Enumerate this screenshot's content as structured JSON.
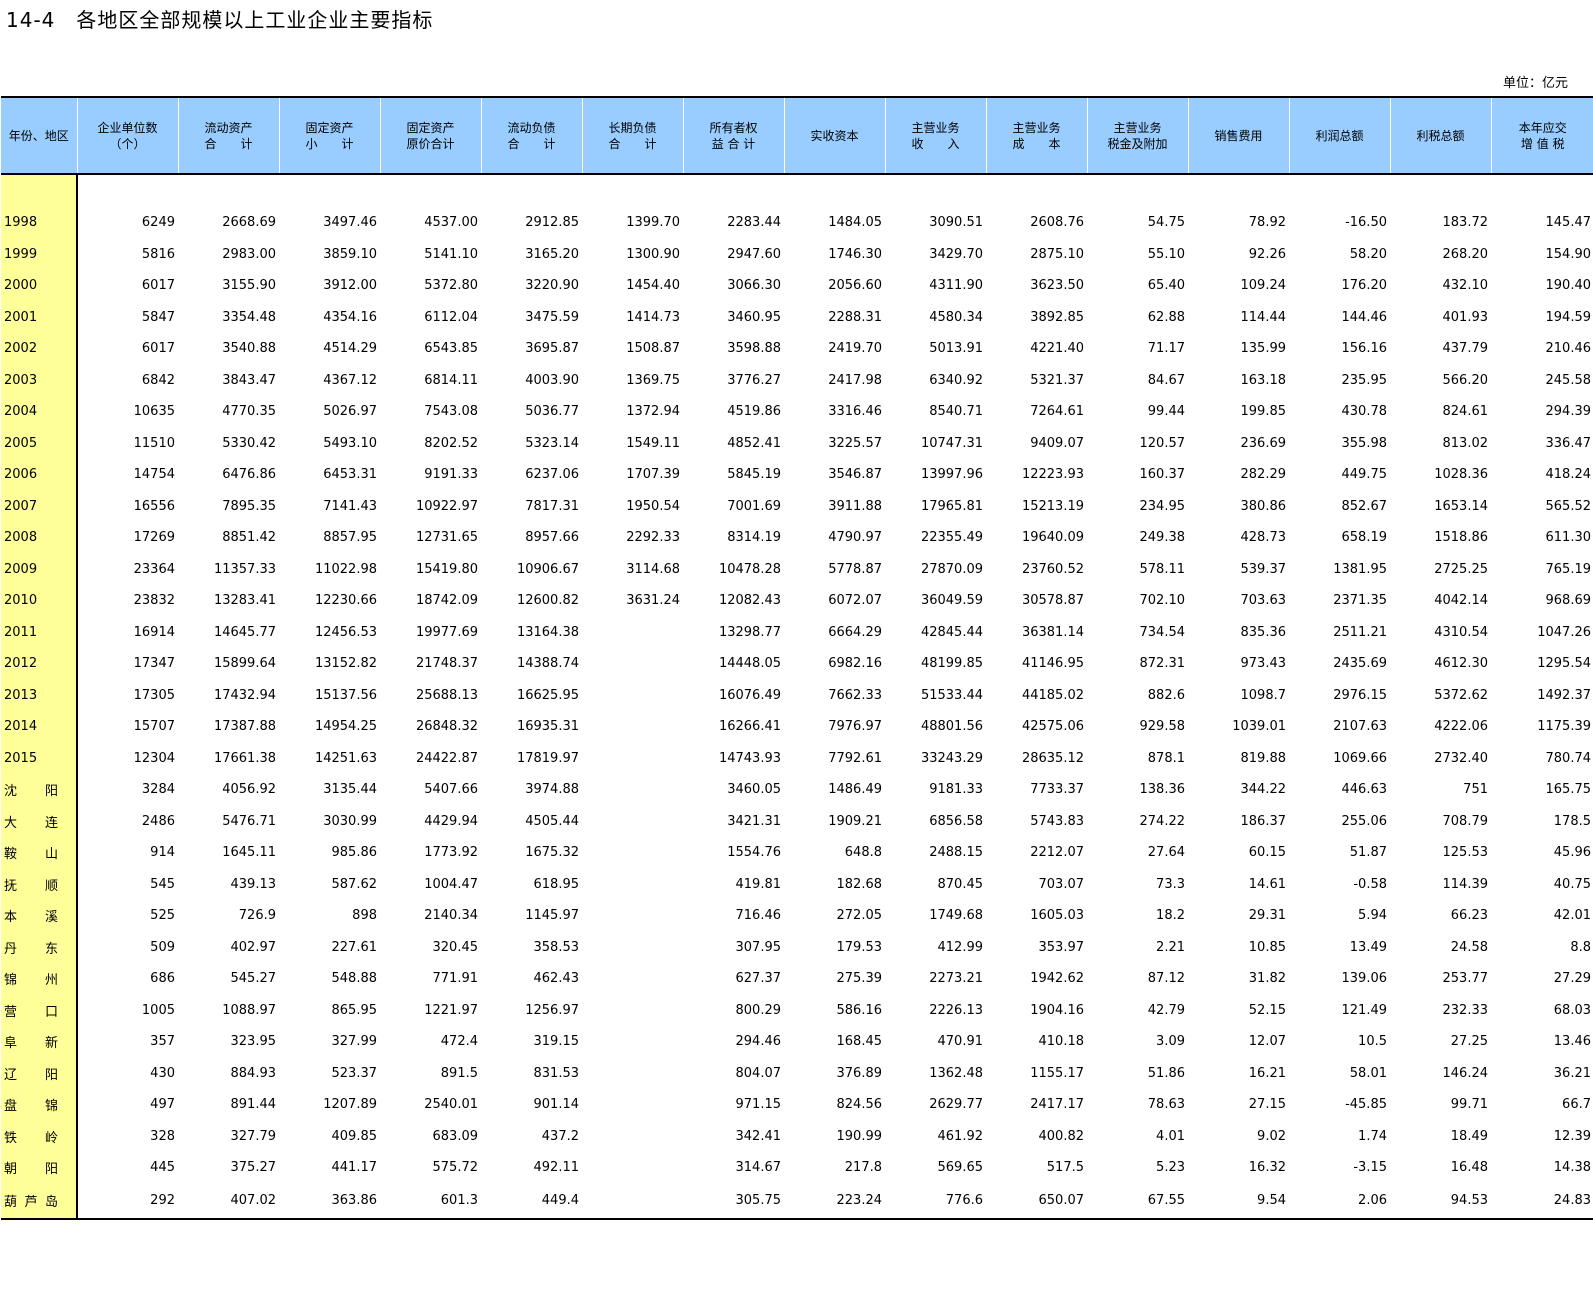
{
  "title": "14-4　各地区全部规模以上工业企业主要指标",
  "unit": "单位：亿元",
  "headers": [
    "年份、地区",
    "企业单位数\n（个）",
    "流动资产\n合　　计",
    "固定资产\n小　　计",
    "固定资产\n原价合计",
    "流动负债\n合　　计",
    "长期负债\n合　　计",
    "所有者权\n益 合 计",
    "实收资本",
    "主营业务\n收　　入",
    "主营业务\n成　　本",
    "主营业务\n税金及附加",
    "销售费用",
    "利润总额",
    "利税总额",
    "本年应交\n增 值 税"
  ],
  "rows": [
    {
      "label": "1998",
      "values": [
        "6249",
        "2668.69",
        "3497.46",
        "4537.00",
        "2912.85",
        "1399.70",
        "2283.44",
        "1484.05",
        "3090.51",
        "2608.76",
        "54.75",
        "78.92",
        "-16.50",
        "183.72",
        "145.47"
      ]
    },
    {
      "label": "1999",
      "values": [
        "5816",
        "2983.00",
        "3859.10",
        "5141.10",
        "3165.20",
        "1300.90",
        "2947.60",
        "1746.30",
        "3429.70",
        "2875.10",
        "55.10",
        "92.26",
        "58.20",
        "268.20",
        "154.90"
      ]
    },
    {
      "label": "2000",
      "values": [
        "6017",
        "3155.90",
        "3912.00",
        "5372.80",
        "3220.90",
        "1454.40",
        "3066.30",
        "2056.60",
        "4311.90",
        "3623.50",
        "65.40",
        "109.24",
        "176.20",
        "432.10",
        "190.40"
      ]
    },
    {
      "label": "2001",
      "values": [
        "5847",
        "3354.48",
        "4354.16",
        "6112.04",
        "3475.59",
        "1414.73",
        "3460.95",
        "2288.31",
        "4580.34",
        "3892.85",
        "62.88",
        "114.44",
        "144.46",
        "401.93",
        "194.59"
      ]
    },
    {
      "label": "2002",
      "values": [
        "6017",
        "3540.88",
        "4514.29",
        "6543.85",
        "3695.87",
        "1508.87",
        "3598.88",
        "2419.70",
        "5013.91",
        "4221.40",
        "71.17",
        "135.99",
        "156.16",
        "437.79",
        "210.46"
      ]
    },
    {
      "label": "2003",
      "values": [
        "6842",
        "3843.47",
        "4367.12",
        "6814.11",
        "4003.90",
        "1369.75",
        "3776.27",
        "2417.98",
        "6340.92",
        "5321.37",
        "84.67",
        "163.18",
        "235.95",
        "566.20",
        "245.58"
      ]
    },
    {
      "label": "2004",
      "values": [
        "10635",
        "4770.35",
        "5026.97",
        "7543.08",
        "5036.77",
        "1372.94",
        "4519.86",
        "3316.46",
        "8540.71",
        "7264.61",
        "99.44",
        "199.85",
        "430.78",
        "824.61",
        "294.39"
      ]
    },
    {
      "label": "2005",
      "values": [
        "11510",
        "5330.42",
        "5493.10",
        "8202.52",
        "5323.14",
        "1549.11",
        "4852.41",
        "3225.57",
        "10747.31",
        "9409.07",
        "120.57",
        "236.69",
        "355.98",
        "813.02",
        "336.47"
      ]
    },
    {
      "label": "2006",
      "values": [
        "14754",
        "6476.86",
        "6453.31",
        "9191.33",
        "6237.06",
        "1707.39",
        "5845.19",
        "3546.87",
        "13997.96",
        "12223.93",
        "160.37",
        "282.29",
        "449.75",
        "1028.36",
        "418.24"
      ]
    },
    {
      "label": "2007",
      "values": [
        "16556",
        "7895.35",
        "7141.43",
        "10922.97",
        "7817.31",
        "1950.54",
        "7001.69",
        "3911.88",
        "17965.81",
        "15213.19",
        "234.95",
        "380.86",
        "852.67",
        "1653.14",
        "565.52"
      ]
    },
    {
      "label": "2008",
      "values": [
        "17269",
        "8851.42",
        "8857.95",
        "12731.65",
        "8957.66",
        "2292.33",
        "8314.19",
        "4790.97",
        "22355.49",
        "19640.09",
        "249.38",
        "428.73",
        "658.19",
        "1518.86",
        "611.30"
      ]
    },
    {
      "label": "2009",
      "values": [
        "23364",
        "11357.33",
        "11022.98",
        "15419.80",
        "10906.67",
        "3114.68",
        "10478.28",
        "5778.87",
        "27870.09",
        "23760.52",
        "578.11",
        "539.37",
        "1381.95",
        "2725.25",
        "765.19"
      ]
    },
    {
      "label": "2010",
      "values": [
        "23832",
        "13283.41",
        "12230.66",
        "18742.09",
        "12600.82",
        "3631.24",
        "12082.43",
        "6072.07",
        "36049.59",
        "30578.87",
        "702.10",
        "703.63",
        "2371.35",
        "4042.14",
        "968.69"
      ]
    },
    {
      "label": "2011",
      "values": [
        "16914",
        "14645.77",
        "12456.53",
        "19977.69",
        "13164.38",
        "",
        "13298.77",
        "6664.29",
        "42845.44",
        "36381.14",
        "734.54",
        "835.36",
        "2511.21",
        "4310.54",
        "1047.26"
      ]
    },
    {
      "label": "2012",
      "values": [
        "17347",
        "15899.64",
        "13152.82",
        "21748.37",
        "14388.74",
        "",
        "14448.05",
        "6982.16",
        "48199.85",
        "41146.95",
        "872.31",
        "973.43",
        "2435.69",
        "4612.30",
        "1295.54"
      ]
    },
    {
      "label": "2013",
      "values": [
        "17305",
        "17432.94",
        "15137.56",
        "25688.13",
        "16625.95",
        "",
        "16076.49",
        "7662.33",
        "51533.44",
        "44185.02",
        "882.6",
        "1098.7",
        "2976.15",
        "5372.62",
        "1492.37"
      ]
    },
    {
      "label": "2014",
      "values": [
        "15707",
        "17387.88",
        "14954.25",
        "26848.32",
        "16935.31",
        "",
        "16266.41",
        "7976.97",
        "48801.56",
        "42575.06",
        "929.58",
        "1039.01",
        "2107.63",
        "4222.06",
        "1175.39"
      ]
    },
    {
      "label": "2015",
      "values": [
        "12304",
        "17661.38",
        "14251.63",
        "24422.87",
        "17819.97",
        "",
        "14743.93",
        "7792.61",
        "33243.29",
        "28635.12",
        "878.1",
        "819.88",
        "1069.66",
        "2732.40",
        "780.74"
      ]
    },
    {
      "label": "沈阳",
      "city": [
        "沈",
        "阳"
      ],
      "values": [
        "3284",
        "4056.92",
        "3135.44",
        "5407.66",
        "3974.88",
        "",
        "3460.05",
        "1486.49",
        "9181.33",
        "7733.37",
        "138.36",
        "344.22",
        "446.63",
        "751",
        "165.75"
      ]
    },
    {
      "label": "大连",
      "city": [
        "大",
        "连"
      ],
      "values": [
        "2486",
        "5476.71",
        "3030.99",
        "4429.94",
        "4505.44",
        "",
        "3421.31",
        "1909.21",
        "6856.58",
        "5743.83",
        "274.22",
        "186.37",
        "255.06",
        "708.79",
        "178.5"
      ]
    },
    {
      "label": "鞍山",
      "city": [
        "鞍",
        "山"
      ],
      "values": [
        "914",
        "1645.11",
        "985.86",
        "1773.92",
        "1675.32",
        "",
        "1554.76",
        "648.8",
        "2488.15",
        "2212.07",
        "27.64",
        "60.15",
        "51.87",
        "125.53",
        "45.96"
      ]
    },
    {
      "label": "抚顺",
      "city": [
        "抚",
        "顺"
      ],
      "values": [
        "545",
        "439.13",
        "587.62",
        "1004.47",
        "618.95",
        "",
        "419.81",
        "182.68",
        "870.45",
        "703.07",
        "73.3",
        "14.61",
        "-0.58",
        "114.39",
        "40.75"
      ]
    },
    {
      "label": "本溪",
      "city": [
        "本",
        "溪"
      ],
      "values": [
        "525",
        "726.9",
        "898",
        "2140.34",
        "1145.97",
        "",
        "716.46",
        "272.05",
        "1749.68",
        "1605.03",
        "18.2",
        "29.31",
        "5.94",
        "66.23",
        "42.01"
      ]
    },
    {
      "label": "丹东",
      "city": [
        "丹",
        "东"
      ],
      "values": [
        "509",
        "402.97",
        "227.61",
        "320.45",
        "358.53",
        "",
        "307.95",
        "179.53",
        "412.99",
        "353.97",
        "2.21",
        "10.85",
        "13.49",
        "24.58",
        "8.8"
      ]
    },
    {
      "label": "锦州",
      "city": [
        "锦",
        "州"
      ],
      "values": [
        "686",
        "545.27",
        "548.88",
        "771.91",
        "462.43",
        "",
        "627.37",
        "275.39",
        "2273.21",
        "1942.62",
        "87.12",
        "31.82",
        "139.06",
        "253.77",
        "27.29"
      ]
    },
    {
      "label": "营口",
      "city": [
        "营",
        "口"
      ],
      "values": [
        "1005",
        "1088.97",
        "865.95",
        "1221.97",
        "1256.97",
        "",
        "800.29",
        "586.16",
        "2226.13",
        "1904.16",
        "42.79",
        "52.15",
        "121.49",
        "232.33",
        "68.03"
      ]
    },
    {
      "label": "阜新",
      "city": [
        "阜",
        "新"
      ],
      "values": [
        "357",
        "323.95",
        "327.99",
        "472.4",
        "319.15",
        "",
        "294.46",
        "168.45",
        "470.91",
        "410.18",
        "3.09",
        "12.07",
        "10.5",
        "27.25",
        "13.46"
      ]
    },
    {
      "label": "辽阳",
      "city": [
        "辽",
        "阳"
      ],
      "values": [
        "430",
        "884.93",
        "523.37",
        "891.5",
        "831.53",
        "",
        "804.07",
        "376.89",
        "1362.48",
        "1155.17",
        "51.86",
        "16.21",
        "58.01",
        "146.24",
        "36.21"
      ]
    },
    {
      "label": "盘锦",
      "city": [
        "盘",
        "锦"
      ],
      "values": [
        "497",
        "891.44",
        "1207.89",
        "2540.01",
        "901.14",
        "",
        "971.15",
        "824.56",
        "2629.77",
        "2417.17",
        "78.63",
        "27.15",
        "-45.85",
        "99.71",
        "66.7"
      ]
    },
    {
      "label": "铁岭",
      "city": [
        "铁",
        "岭"
      ],
      "values": [
        "328",
        "327.79",
        "409.85",
        "683.09",
        "437.2",
        "",
        "342.41",
        "190.99",
        "461.92",
        "400.82",
        "4.01",
        "9.02",
        "1.74",
        "18.49",
        "12.39"
      ]
    },
    {
      "label": "朝阳",
      "city": [
        "朝",
        "阳"
      ],
      "values": [
        "445",
        "375.27",
        "441.17",
        "575.72",
        "492.11",
        "",
        "314.67",
        "217.8",
        "569.65",
        "517.5",
        "5.23",
        "16.32",
        "-3.15",
        "16.48",
        "14.38"
      ]
    },
    {
      "label": "葫芦岛",
      "city": [
        "葫",
        "芦",
        "岛"
      ],
      "values": [
        "292",
        "407.02",
        "363.86",
        "601.3",
        "449.4",
        "",
        "305.75",
        "223.24",
        "776.6",
        "650.07",
        "67.55",
        "9.54",
        "2.06",
        "94.53",
        "24.83"
      ]
    }
  ]
}
